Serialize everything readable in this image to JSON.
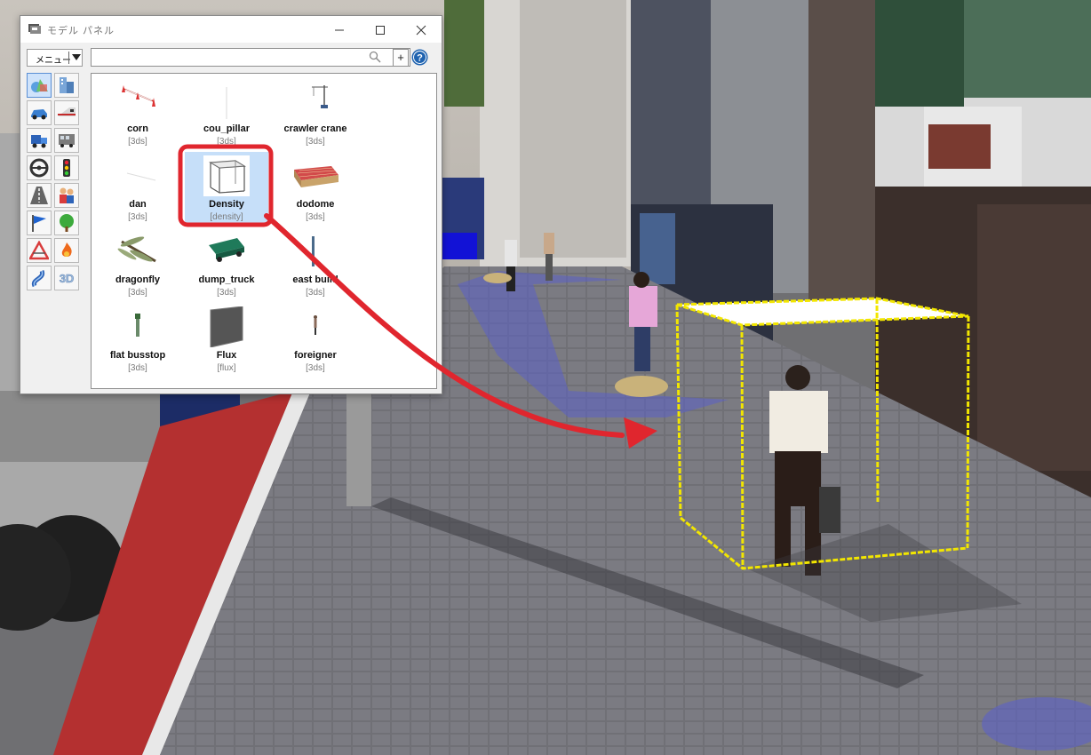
{
  "window": {
    "title": "モデル パネル",
    "menu_label": "メニュー",
    "search_value": "",
    "search_placeholder": "",
    "add_label": "+",
    "help_label": "?"
  },
  "categories": [
    {
      "icon": "shapes-icon",
      "selected": true
    },
    {
      "icon": "buildings-icon",
      "selected": false
    },
    {
      "icon": "car-icon",
      "selected": false
    },
    {
      "icon": "train-icon",
      "selected": false
    },
    {
      "icon": "truck-icon",
      "selected": false
    },
    {
      "icon": "bus-icon",
      "selected": false
    },
    {
      "icon": "steering-wheel-icon",
      "selected": false
    },
    {
      "icon": "traffic-light-icon",
      "selected": false
    },
    {
      "icon": "road-icon",
      "selected": false
    },
    {
      "icon": "people-icon",
      "selected": false
    },
    {
      "icon": "flag-icon",
      "selected": false
    },
    {
      "icon": "tree-icon",
      "selected": false
    },
    {
      "icon": "road-sign-icon",
      "selected": false
    },
    {
      "icon": "fire-icon",
      "selected": false
    },
    {
      "icon": "curve-icon",
      "selected": false
    },
    {
      "icon": "3d-text-icon",
      "selected": false
    }
  ],
  "models": [
    {
      "name": "corn",
      "format": "[3ds]",
      "icon": "cone-icon"
    },
    {
      "name": "cou_pillar",
      "format": "[3ds]",
      "icon": "pillar-icon"
    },
    {
      "name": "crawler crane",
      "format": "[3ds]",
      "icon": "crane-icon"
    },
    {
      "name": "dan",
      "format": "[3ds]",
      "icon": "dan-icon"
    },
    {
      "name": "Density",
      "format": "[density]",
      "icon": "density-box-icon",
      "selected": true
    },
    {
      "name": "dodome",
      "format": "[3ds]",
      "icon": "dodome-icon"
    },
    {
      "name": "dragonfly",
      "format": "[3ds]",
      "icon": "dragonfly-icon"
    },
    {
      "name": "dump_truck",
      "format": "[3ds]",
      "icon": "dump-truck-icon"
    },
    {
      "name": "east build",
      "format": "[3ds]",
      "icon": "east-build-icon"
    },
    {
      "name": "flat busstop",
      "format": "[3ds]",
      "icon": "busstop-icon"
    },
    {
      "name": "Flux",
      "format": "[flux]",
      "icon": "flux-icon"
    },
    {
      "name": "foreigner",
      "format": "[3ds]",
      "icon": "person-icon"
    }
  ],
  "colors": {
    "selection_bg": "#c6dff9",
    "annotation_red": "#e0262e",
    "density_box_yellow": "#f2e600"
  }
}
